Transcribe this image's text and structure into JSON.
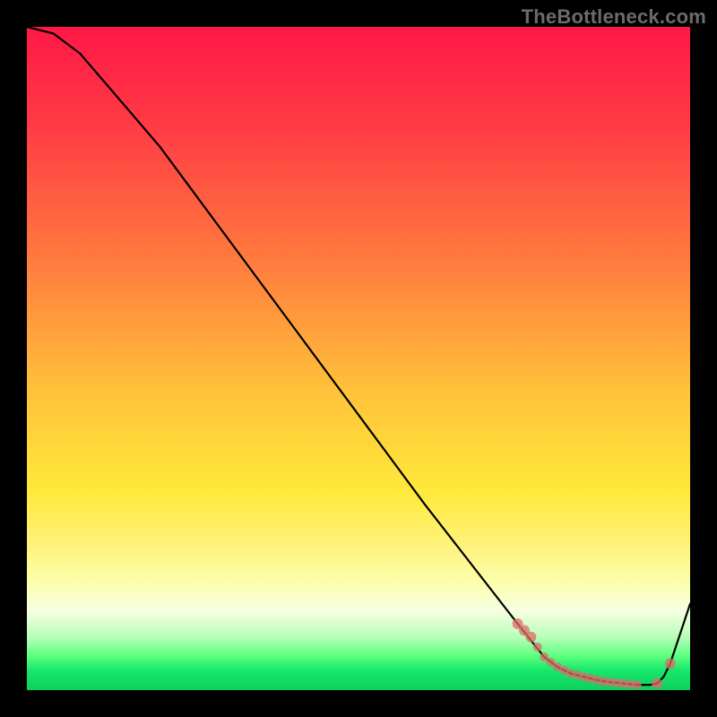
{
  "watermark": "TheBottleneck.com",
  "colors": {
    "marker": "#e06a6a",
    "curve": "#000000",
    "background": "#000000",
    "gradient_stops": [
      "#ff1846",
      "#ff3b45",
      "#ff7a3e",
      "#ffc23a",
      "#ffe93a",
      "#fff27a",
      "#fcffb0",
      "#f7ffe2",
      "#b8ffb8",
      "#58ff7d",
      "#17e86a",
      "#0ecf5e"
    ]
  },
  "chart_data": {
    "type": "line",
    "title": "",
    "xlabel": "",
    "ylabel": "",
    "xlim": [
      0,
      100
    ],
    "ylim": [
      0,
      100
    ],
    "series": [
      {
        "name": "curve",
        "x": [
          0,
          4,
          8,
          20,
          40,
          60,
          74,
          78,
          80,
          82,
          84,
          86,
          88,
          90,
          92,
          94,
          95,
          96,
          97,
          98,
          100
        ],
        "y": [
          100,
          99,
          96,
          82,
          55,
          28,
          10,
          5,
          3.5,
          2.5,
          2,
          1.5,
          1.2,
          1,
          0.8,
          0.8,
          1,
          2,
          4,
          7,
          13
        ],
        "_note": "y is bottleneck-like metric (% of max); plateau ~0.8–1 across x≈90–94, then rises again"
      }
    ],
    "markers": {
      "name": "plateau-highlight",
      "x": [
        74,
        75,
        76,
        77,
        78,
        79,
        80,
        81,
        82,
        83,
        84,
        85,
        86,
        87,
        88,
        89,
        90,
        91,
        92,
        95,
        97
      ],
      "y": [
        10,
        9,
        8,
        6.5,
        5,
        4.2,
        3.5,
        3,
        2.5,
        2.3,
        2,
        1.8,
        1.5,
        1.3,
        1.2,
        1.1,
        1,
        0.9,
        0.8,
        1,
        4
      ]
    }
  }
}
